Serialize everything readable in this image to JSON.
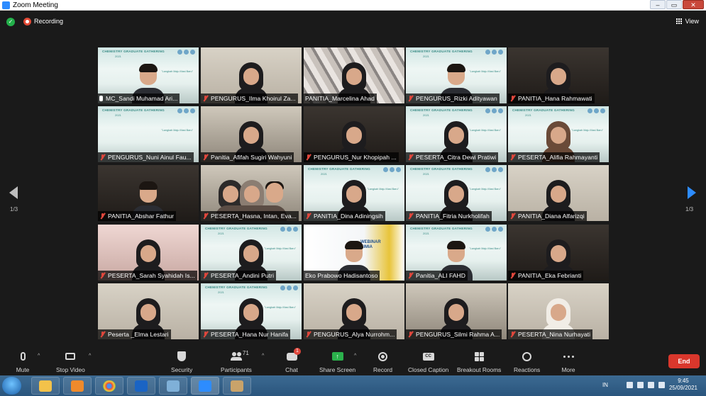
{
  "window": {
    "title": "Zoom Meeting",
    "controls": [
      "–",
      "▭",
      "✕"
    ]
  },
  "topbar": {
    "recording_label": "Recording",
    "view_label": "View"
  },
  "pager": {
    "left": "1/3",
    "right": "1/3"
  },
  "cgg_banner": {
    "title": "CHEMISTRY GRADUATE GATHERING",
    "year": "2021",
    "tagline": "\"Langkah Maju Masi Baru\""
  },
  "webinar_text": "WEBINAR KIMIA",
  "tiles": [
    {
      "name": "MC_Sandi Muhamad Ari...",
      "mic": "on",
      "bg": "cgg",
      "active": true,
      "person": "m-dark"
    },
    {
      "name": "PENGURUS_Ilma Khoirul Za...",
      "mic": "off",
      "bg": "wall-light",
      "person": "hijab-black"
    },
    {
      "name": "PANITIA_Marcelina Ahad",
      "mic": "none",
      "bg": "tri",
      "person": "hijab-black"
    },
    {
      "name": "PENGURUS_Rizki Adityawan",
      "mic": "off",
      "bg": "cgg",
      "person": "m-dark"
    },
    {
      "name": "PANITIA_Hana Rahmawati",
      "mic": "off",
      "bg": "room-dark",
      "person": "hijab-black"
    },
    {
      "name": "PENGURUS_Nuni Ainul Fau...",
      "mic": "off",
      "bg": "cgg",
      "person": "none"
    },
    {
      "name": "Panitia_Afifah Sugiri Wahyuni",
      "mic": "off",
      "bg": "room-light",
      "person": "hijab-black"
    },
    {
      "name": "PENGURUS_Nur Khopipah ...",
      "mic": "off",
      "bg": "room-dark",
      "person": "hijab-black"
    },
    {
      "name": "PESERTA_Citra Dewi Pratiwi",
      "mic": "off",
      "bg": "cgg",
      "person": "hijab-black"
    },
    {
      "name": "PESERTA_Alifia Rahmayanti",
      "mic": "off",
      "bg": "cgg",
      "person": "hijab-brown"
    },
    {
      "name": "PANITIA_Abshar Fathur",
      "mic": "off",
      "bg": "room-dark",
      "person": "m-dark"
    },
    {
      "name": "PESERTA_Hasna, Intan, Eva...",
      "mic": "off",
      "bg": "room-light",
      "person": "group"
    },
    {
      "name": "PANITIA_Dina Adiningsih",
      "mic": "off",
      "bg": "cgg",
      "person": "hijab-black"
    },
    {
      "name": "PANITIA_Fitria Nurkholifah",
      "mic": "off",
      "bg": "cgg",
      "person": "hijab-black"
    },
    {
      "name": "PANITIA_Diana Alfarizqi",
      "mic": "off",
      "bg": "wall-light",
      "person": "hijab-black"
    },
    {
      "name": "PESERTA_Sarah Syahidah Is...",
      "mic": "off",
      "bg": "room-pink",
      "person": "hijab-black"
    },
    {
      "name": "PESERTA_Andini Putri",
      "mic": "off",
      "bg": "cgg",
      "person": "hijab-black"
    },
    {
      "name": "Eko Prabowo Hadisantoso",
      "mic": "none",
      "bg": "webinar",
      "person": "m-dark"
    },
    {
      "name": "Panitia_ALI FAHD",
      "mic": "off",
      "bg": "cgg",
      "person": "m-dark"
    },
    {
      "name": "PANITIA_Eka Febrianti",
      "mic": "off",
      "bg": "room-dark",
      "person": "hijab-black"
    },
    {
      "name": "Peserta _Elma Lestari",
      "mic": "off",
      "bg": "wall-light",
      "person": "hijab-black"
    },
    {
      "name": "PESERTA_Hana Nur Hanifa",
      "mic": "off",
      "bg": "cgg",
      "person": "hijab-black"
    },
    {
      "name": "PENGURUS_Alya Nurrohm...",
      "mic": "off",
      "bg": "wall-light",
      "person": "hijab-black"
    },
    {
      "name": "PENGURUS_Silmi Rahma A...",
      "mic": "off",
      "bg": "room-light",
      "person": "hijab-black"
    },
    {
      "name": "PESERTA_Nina Nurhayati",
      "mic": "off",
      "bg": "wall-light",
      "person": "hijab-white"
    }
  ],
  "toolbar": {
    "mute": "Mute",
    "stop_video": "Stop Video",
    "security": "Security",
    "participants": "Participants",
    "participants_count": "71",
    "chat": "Chat",
    "chat_badge": "1",
    "share_screen": "Share Screen",
    "record": "Record",
    "closed_caption": "Closed Caption",
    "breakout_rooms": "Breakout Rooms",
    "reactions": "Reactions",
    "more": "More",
    "end": "End",
    "cc_glyph": "CC"
  },
  "taskbar": {
    "lang": "IN",
    "time": "9:45",
    "date": "25/09/2021",
    "apps": [
      "explorer",
      "media-player",
      "chrome",
      "bluetooth",
      "network-app",
      "zoom",
      "paint"
    ]
  },
  "colors": {
    "accent_blue": "#2d8cff",
    "mute_red": "#e0473c",
    "share_green": "#2bb14c",
    "end_red": "#d9372c",
    "active_speaker": "#f5e046"
  }
}
